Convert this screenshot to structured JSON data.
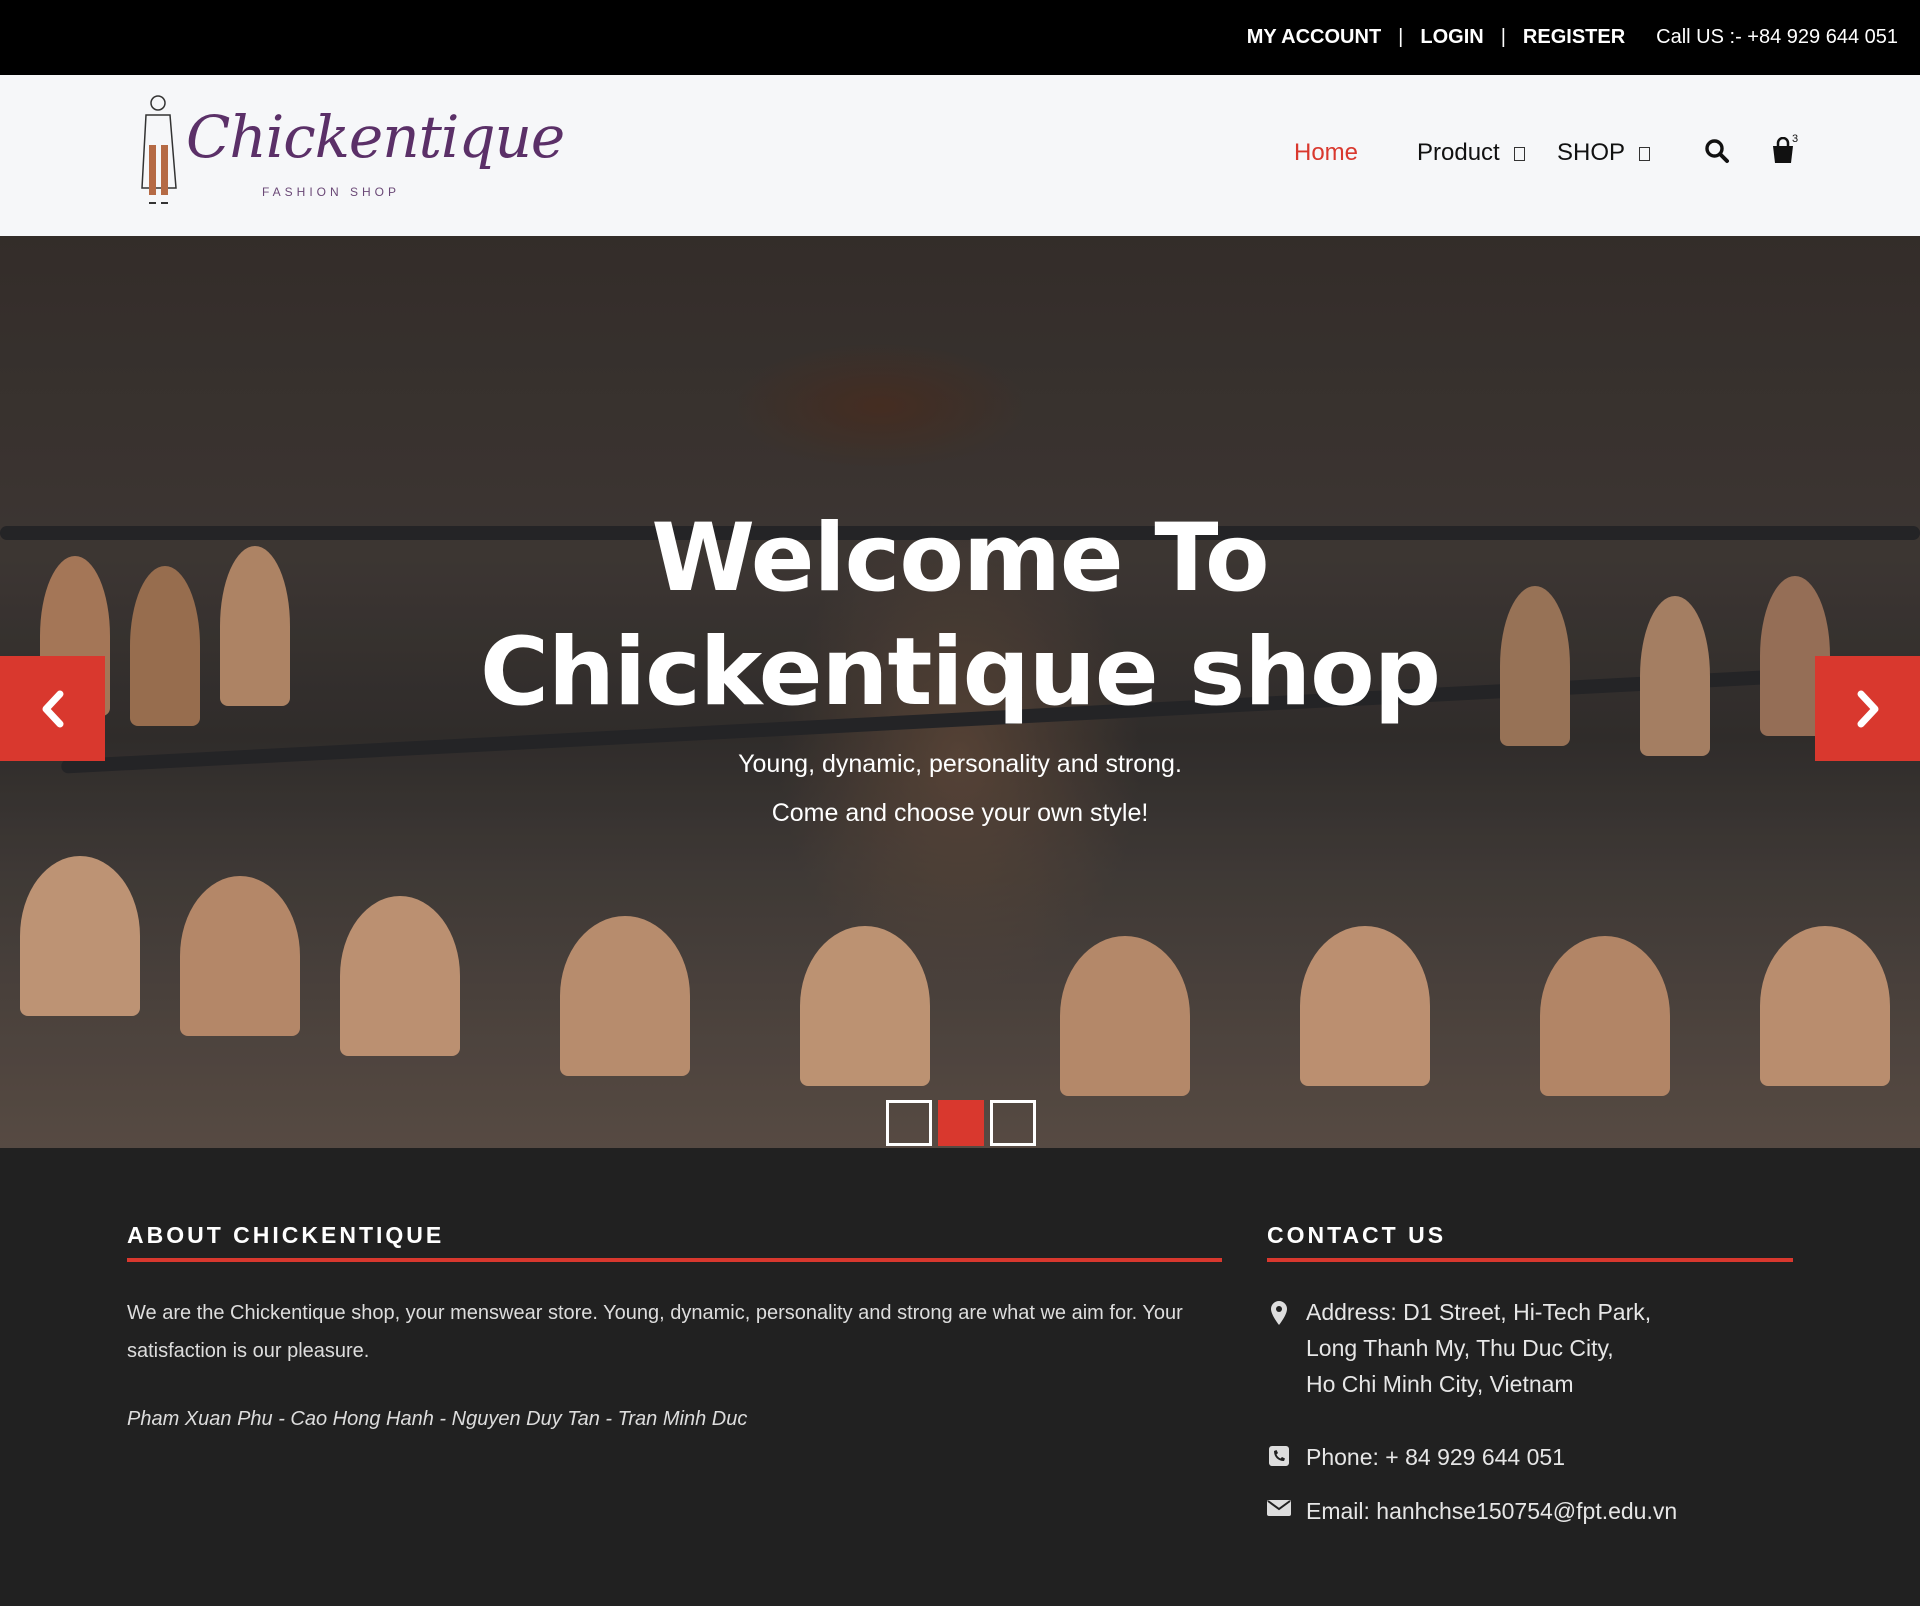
{
  "topbar": {
    "my_account": "MY ACCOUNT",
    "login": "LOGIN",
    "register": "REGISTER",
    "call": "Call US :- +84 929 644 051"
  },
  "header": {
    "logo_script": "Chickentique",
    "logo_sub": "FASHION SHOP",
    "nav": {
      "home": "Home",
      "product": "Product",
      "shop": "SHOP"
    },
    "icons": [
      "search-icon",
      "shopping-bag-icon"
    ],
    "cart_count": "3"
  },
  "hero": {
    "title_line1": "Welcome To",
    "title_line2": "Chickentique shop",
    "line1": "Young, dynamic, personality and strong.",
    "line2": "Come and choose your own style!",
    "slides": 3,
    "active_slide": 2
  },
  "about": {
    "heading": "ABOUT CHICKENTIQUE",
    "text": "We are the Chickentique shop, your menswear store. Young, dynamic, personality and strong are what we aim for. Your satisfaction is our pleasure.",
    "authors": "Pham Xuan Phu - Cao Hong Hanh - Nguyen Duy Tan - Tran Minh Duc"
  },
  "contact": {
    "heading": "CONTACT US",
    "address_1": "Address: D1 Street, Hi-Tech Park,",
    "address_2": "Long Thanh My, Thu Duc City,",
    "address_3": "Ho Chi Minh City, Vietnam",
    "phone": "Phone: + 84 929 644 051",
    "email": "Email: hanhchse150754@fpt.edu.vn"
  },
  "colors": {
    "accent": "#d9382e",
    "topbar": "#000000",
    "header_bg": "#f6f7f9",
    "footer_bg": "#212121",
    "logo": "#5b3068"
  }
}
